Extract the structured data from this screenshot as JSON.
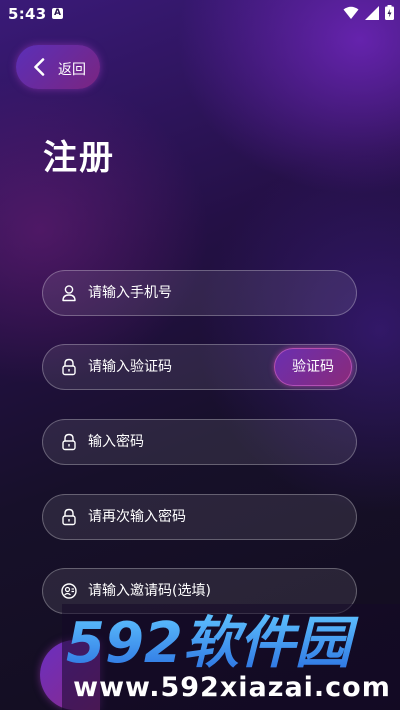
{
  "status_bar": {
    "time": "5:43",
    "notif_glyph": "A"
  },
  "back": {
    "label": "返回"
  },
  "title": "注册",
  "fields": [
    {
      "icon": "user-icon",
      "placeholder": "请输入手机号"
    },
    {
      "icon": "lock-icon",
      "placeholder": "请输入验证码",
      "action_label": "验证码"
    },
    {
      "icon": "lock-icon",
      "placeholder": "输入密码"
    },
    {
      "icon": "lock-icon",
      "placeholder": "请再次输入密码"
    },
    {
      "icon": "contact-icon",
      "placeholder": "请输入邀请码(选填)"
    }
  ],
  "watermark": {
    "logo_text": "592软件园",
    "url": "www.592xiazai.com"
  },
  "colors": {
    "accent": "#7a2f9e",
    "gradient_start": "#5b2fb8",
    "gradient_end": "#8a2a7a"
  }
}
